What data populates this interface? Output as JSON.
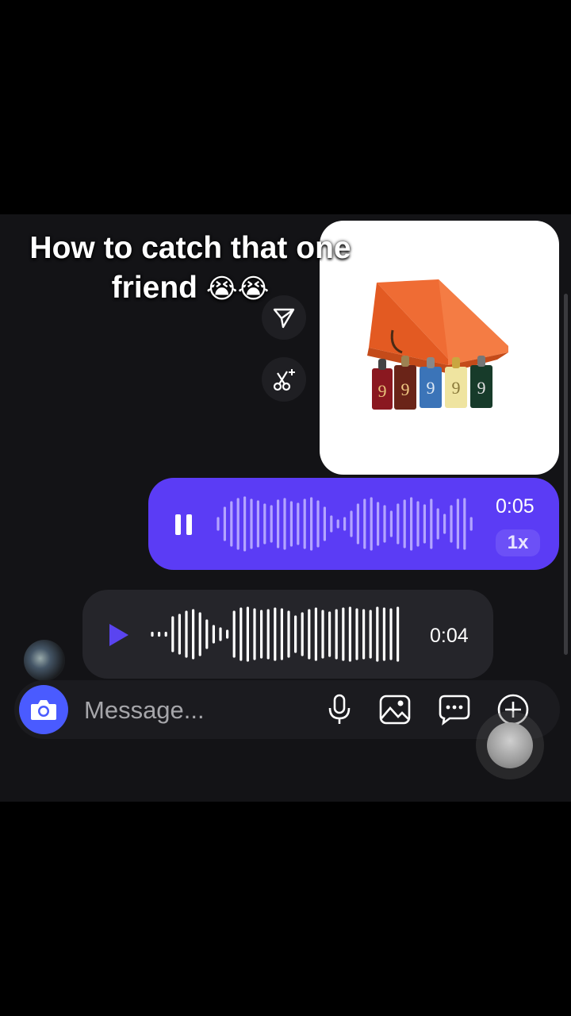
{
  "overlay": {
    "caption_line1": "How to catch that one",
    "caption_line2": "friend",
    "caption_emoji": "😭😭"
  },
  "chat": {
    "shared_image": {
      "description_icon": "perfume-gift-box-image",
      "bottle_labels": [
        "9",
        "9",
        "9",
        "9",
        "9"
      ]
    },
    "actions": {
      "share_icon": "send-icon",
      "quick_reply_icon": "sparkle-scissors-icon"
    },
    "sent_voice": {
      "duration": "0:05",
      "speed": "1x",
      "state_icon": "pause-icon"
    },
    "received_voice": {
      "duration": "0:04",
      "state_icon": "play-icon"
    }
  },
  "composer": {
    "placeholder": "Message...",
    "icons": [
      "camera-icon",
      "microphone-icon",
      "image-icon",
      "chat-bubble-icon",
      "plus-icon"
    ]
  },
  "colors": {
    "sent_bubble": "#5b3cf5",
    "received_bubble": "#25252a",
    "camera_button": "#4a5bff",
    "chat_background": "#131316"
  }
}
